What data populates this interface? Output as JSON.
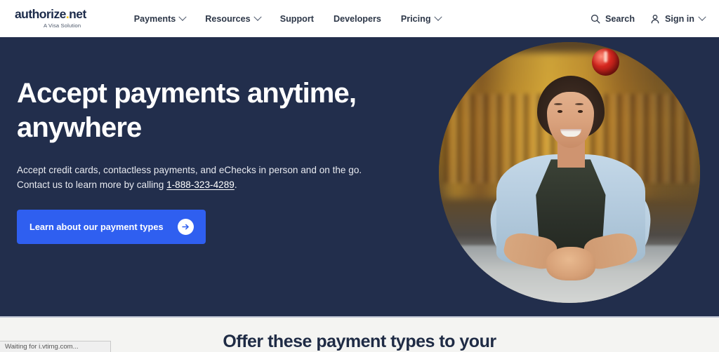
{
  "header": {
    "logo": {
      "name_main": "authorize",
      "name_dot": ".",
      "name_tld": "net",
      "tagline": "A Visa Solution"
    },
    "nav_items": [
      {
        "label": "Payments",
        "has_chevron": true
      },
      {
        "label": "Resources",
        "has_chevron": true
      },
      {
        "label": "Support",
        "has_chevron": false
      },
      {
        "label": "Developers",
        "has_chevron": false
      },
      {
        "label": "Pricing",
        "has_chevron": true
      }
    ],
    "search_label": "Search",
    "signin_label": "Sign in"
  },
  "hero": {
    "title": "Accept payments anytime, anywhere",
    "subtitle_part1": "Accept credit cards, contactless payments, and eChecks in person and on the go. Contact us to learn more by calling ",
    "phone": "1-888-323-4289",
    "subtitle_part2": ".",
    "cta_label": "Learn about our payment types",
    "photo_alt": "Smiling woman in a light blue shirt and dark apron leaning on a bar counter",
    "background_color": "#222e4c"
  },
  "section": {
    "title": "Offer these payment types to your"
  },
  "statusbar": {
    "text": "Waiting for i.vtimg.com..."
  },
  "colors": {
    "navy": "#222e4c",
    "accent_blue": "#2f5ff0",
    "logo_gold": "#f5c518",
    "page_bg": "#f4f4f2"
  }
}
